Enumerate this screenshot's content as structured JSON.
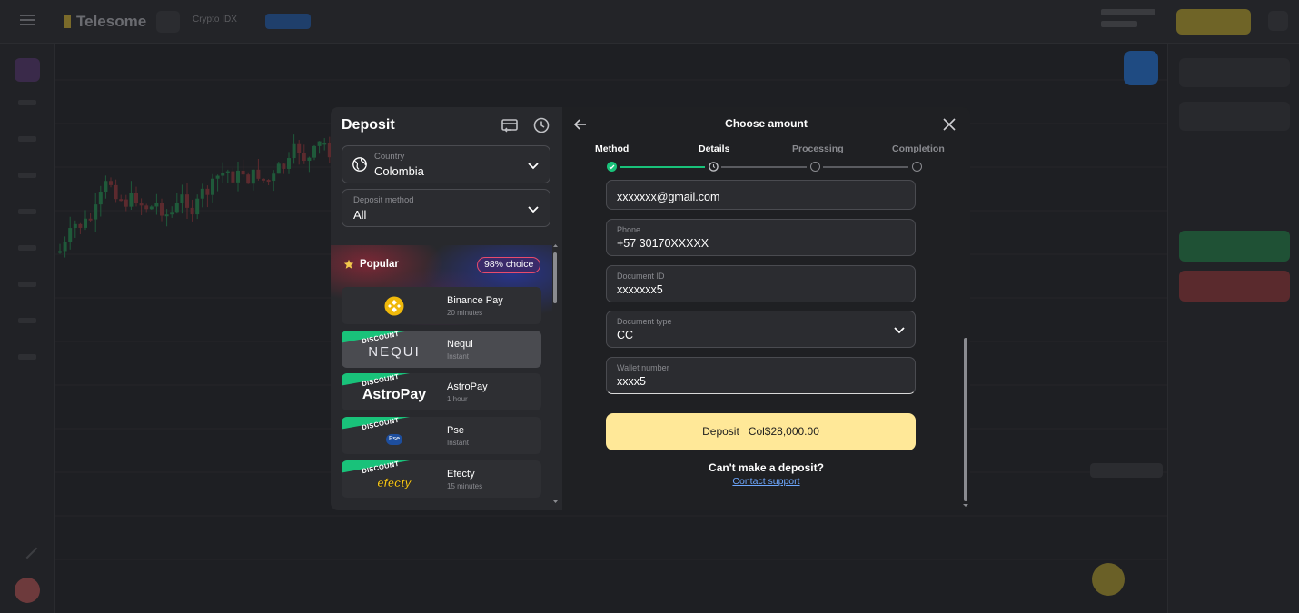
{
  "background": {
    "app_logo": "Telesome",
    "pair": "Crypto IDX"
  },
  "deposit": {
    "title": "Deposit",
    "country": {
      "label": "Country",
      "value": "Colombia"
    },
    "method": {
      "label": "Deposit method",
      "value": "All"
    },
    "popular": {
      "title": "Popular",
      "badge": "98% choice"
    },
    "methods": [
      {
        "name": "Binance Pay",
        "sub": "20 minutes",
        "logo": "binance",
        "discount": ""
      },
      {
        "name": "Nequi",
        "sub": "Instant",
        "logo": "NEQUI",
        "discount": "DISCOUNT"
      },
      {
        "name": "AstroPay",
        "sub": "1 hour",
        "logo": "AstroPay",
        "discount": "DISCOUNT"
      },
      {
        "name": "Pse",
        "sub": "Instant",
        "logo": "Pse",
        "discount": "DISCOUNT"
      },
      {
        "name": "Efecty",
        "sub": "15 minutes",
        "logo": "efecty",
        "discount": "DISCOUNT"
      }
    ]
  },
  "amount": {
    "title": "Choose amount",
    "steps": [
      {
        "label": "Method",
        "state": "done"
      },
      {
        "label": "Details",
        "state": "current"
      },
      {
        "label": "Processing",
        "state": "todo"
      },
      {
        "label": "Completion",
        "state": "todo"
      }
    ],
    "email_value": "xxxxxxx@gmail.com",
    "phone": {
      "label": "Phone",
      "value": "+57 30170XXXXX"
    },
    "document_id": {
      "label": "Document ID",
      "value": "xxxxxxx5"
    },
    "document_type": {
      "label": "Document type",
      "value": "CC"
    },
    "wallet": {
      "label": "Wallet number",
      "value": "xxxx5"
    },
    "deposit_button": "Deposit   Col$28,000.00",
    "cant_deposit": "Can't make a deposit?",
    "contact_support": "Contact support"
  },
  "colors": {
    "accent_yellow": "#ffe898",
    "success_green": "#19c27a",
    "link_blue": "#6ea8ff"
  }
}
